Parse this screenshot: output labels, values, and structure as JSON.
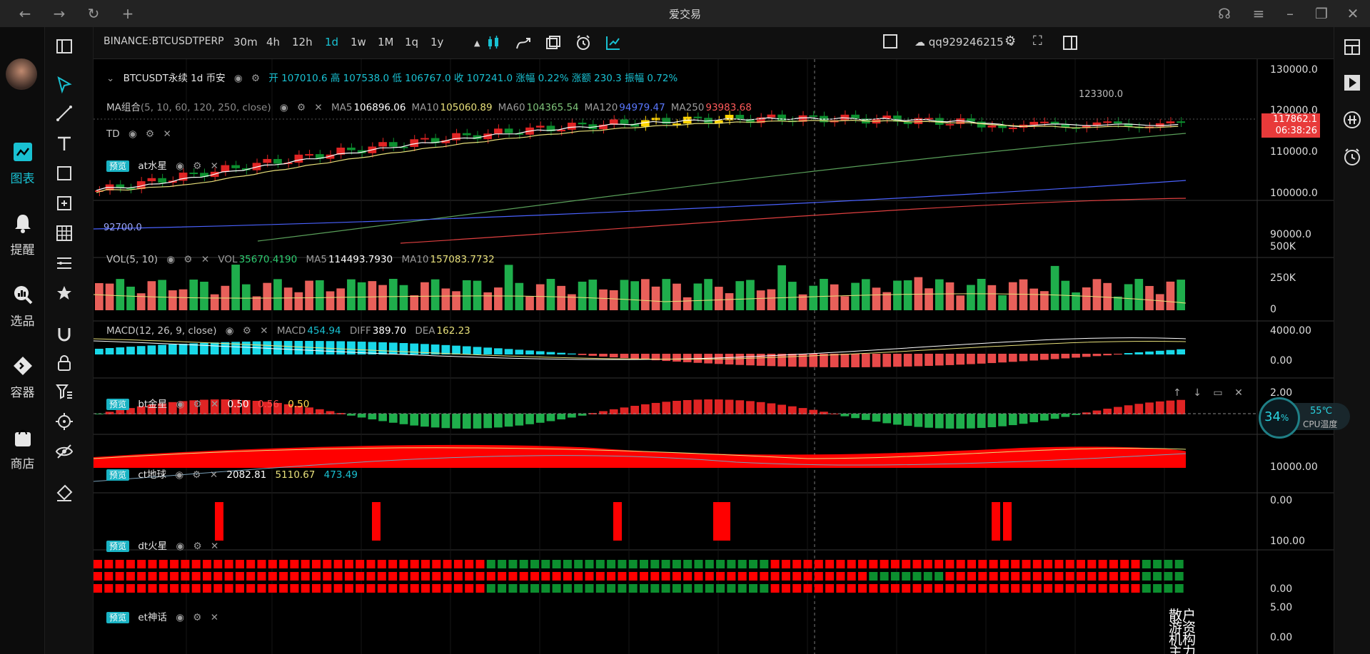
{
  "app": {
    "title": "爱交易"
  },
  "nav": {
    "items": [
      {
        "label": "图表",
        "icon": "chart-icon",
        "active": true
      },
      {
        "label": "提醒",
        "icon": "bell-icon"
      },
      {
        "label": "选品",
        "icon": "search-chart-icon"
      },
      {
        "label": "容器",
        "icon": "container-icon"
      },
      {
        "label": "商店",
        "icon": "shop-icon"
      }
    ]
  },
  "toolbar": {
    "symbol": "BINANCE:BTCUSDTPERP",
    "intervals": [
      "30m",
      "4h",
      "12h",
      "1d",
      "1w",
      "1M",
      "1q",
      "1y"
    ],
    "active_interval": "1d",
    "user": "qq929246215"
  },
  "main_pane": {
    "title": "BTCUSDT永续  1d  币安",
    "ohlc": "开 107010.6  高 107538.0  低 106767.0  收 107241.0  涨幅 0.22%  涨额 230.3  振幅 0.72%",
    "ma_name": "MA组合",
    "ma_params": "(5, 10, 60, 120, 250, close)",
    "ma_values": [
      {
        "label": "MA5",
        "value": "106896.06",
        "color": "#ffffff"
      },
      {
        "label": "MA10",
        "value": "105060.89",
        "color": "#e8e07a"
      },
      {
        "label": "MA60",
        "value": "104365.54",
        "color": "#7fc47a"
      },
      {
        "label": "MA120",
        "value": "94979.47",
        "color": "#5a78ff"
      },
      {
        "label": "MA250",
        "value": "93983.68",
        "color": "#ff5a5a"
      }
    ],
    "td_label": "TD",
    "at_label": "at水星",
    "price_labels": [
      "130000.0",
      "120000.0",
      "110000.0",
      "100000.0",
      "90000.0"
    ],
    "current_price": "117862.1",
    "countdown": "06:38:26",
    "high_annot": "123300.0",
    "low_annot": "92700.0"
  },
  "vol_pane": {
    "title": "VOL(5, 10)",
    "vol": "35670.4190",
    "ma5": "114493.7930",
    "ma10": "157083.7732",
    "axis": [
      "500K",
      "250K",
      "0"
    ]
  },
  "macd_pane": {
    "title": "MACD(12, 26, 9, close)",
    "macd": "454.94",
    "diff": "389.70",
    "dea": "162.23",
    "axis": [
      "4000.00",
      "0.00"
    ]
  },
  "bt_pane": {
    "name": "bt金星",
    "v1": "0.50",
    "v2": "0.56",
    "v3": "0.50",
    "axis": [
      "2.00"
    ]
  },
  "ct_pane": {
    "name": "ct地球",
    "v1": "2082.81",
    "v2": "5110.67",
    "v3": "473.49",
    "axis": [
      "10000.00",
      "0.00"
    ]
  },
  "dt_pane": {
    "name": "dt火星",
    "axis": [
      "100.00",
      "0.00"
    ]
  },
  "et_pane": {
    "name": "et神话",
    "axis": [
      "5.00",
      "0.00"
    ],
    "labels": [
      "散户",
      "游资",
      "机构",
      "主力"
    ]
  },
  "preview_badge": "预览",
  "cpu": {
    "percent": "34",
    "unit": "%",
    "temp": "55℃",
    "label": "CPU温度"
  }
}
